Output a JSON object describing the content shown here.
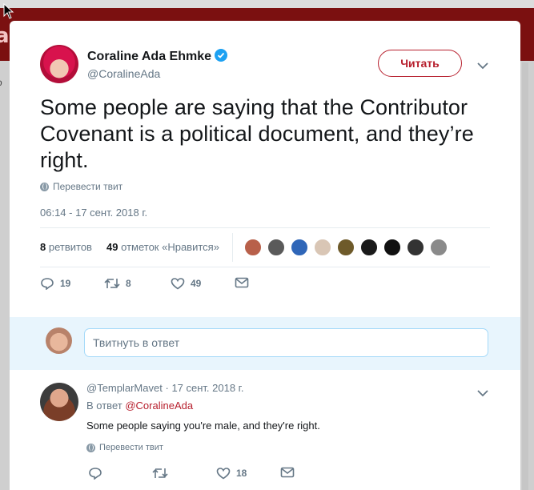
{
  "background": {
    "logo_fragment": "a",
    "nav_fragment": "о"
  },
  "tweet": {
    "author_name": "Coraline Ada Ehmke",
    "author_handle": "@CoralineAda",
    "follow_label": "Читать",
    "text": "Some people are saying that the Contributor Covenant is a political document, and they’re right.",
    "translate_label": "Перевести твит",
    "timestamp": "06:14 - 17 сент. 2018 г.",
    "retweets_count": "8",
    "retweets_label": "ретвитов",
    "likes_count": "49",
    "likes_label": "отметок «Нравится»",
    "actions": {
      "replies": "19",
      "retweets": "8",
      "likes": "49"
    }
  },
  "compose": {
    "placeholder": "Твитнуть в ответ"
  },
  "reply": {
    "handle": "@TemplarMavet",
    "separator": "·",
    "date": "17 сент. 2018 г.",
    "in_reply_prefix": "В ответ",
    "in_reply_mention": "@CoralineAda",
    "text": "Some people saying you're male, and they're right.",
    "translate_label": "Перевести твит",
    "actions": {
      "replies": "",
      "retweets": "",
      "likes": "18"
    }
  },
  "colors": {
    "brand_red": "#b7202e",
    "verified_blue": "#1da1f2",
    "muted_text": "#657786"
  }
}
